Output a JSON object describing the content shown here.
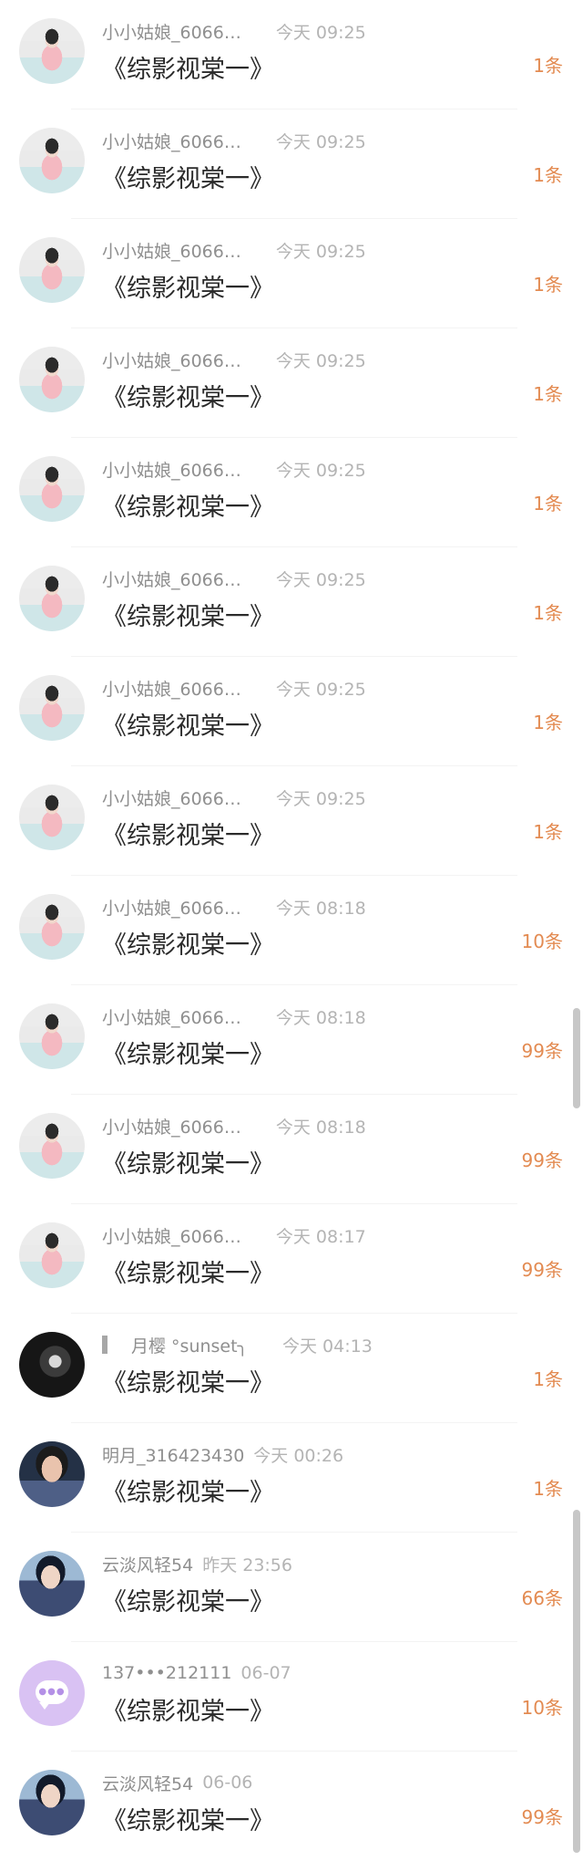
{
  "items": [
    {
      "name": "小小姑娘_6066…",
      "time": "今天  09:25",
      "title": "《综影视棠一》",
      "count": "1条"
    },
    {
      "name": "小小姑娘_6066…",
      "time": "今天  09:25",
      "title": "《综影视棠一》",
      "count": "1条"
    },
    {
      "name": "小小姑娘_6066…",
      "time": "今天  09:25",
      "title": "《综影视棠一》",
      "count": "1条"
    },
    {
      "name": "小小姑娘_6066…",
      "time": "今天  09:25",
      "title": "《综影视棠一》",
      "count": "1条"
    },
    {
      "name": "小小姑娘_6066…",
      "time": "今天  09:25",
      "title": "《综影视棠一》",
      "count": "1条"
    },
    {
      "name": "小小姑娘_6066…",
      "time": "今天  09:25",
      "title": "《综影视棠一》",
      "count": "1条"
    },
    {
      "name": "小小姑娘_6066…",
      "time": "今天  09:25",
      "title": "《综影视棠一》",
      "count": "1条"
    },
    {
      "name": "小小姑娘_6066…",
      "time": "今天  09:25",
      "title": "《综影视棠一》",
      "count": "1条"
    },
    {
      "name": "小小姑娘_6066…",
      "time": "今天  08:18",
      "title": "《综影视棠一》",
      "count": "10条"
    },
    {
      "name": "小小姑娘_6066…",
      "time": "今天  08:18",
      "title": "《综影视棠一》",
      "count": "99条"
    },
    {
      "name": "小小姑娘_6066…",
      "time": "今天  08:18",
      "title": "《综影视棠一》",
      "count": "99条"
    },
    {
      "name": "小小姑娘_6066…",
      "time": "今天  08:17",
      "title": "《综影视棠一》",
      "count": "99条"
    },
    {
      "name": "月樱 °sunset╮",
      "time": "今天  04:13",
      "title": "《综影视棠一》",
      "count": "1条"
    },
    {
      "name": "明月_316423430",
      "time": "今天  00:26",
      "title": "《综影视棠一》",
      "count": "1条"
    },
    {
      "name": "云淡风轻54",
      "time": "昨天  23:56",
      "title": "《综影视棠一》",
      "count": "66条"
    },
    {
      "name": "137•••212111",
      "time": "06-07",
      "title": "《综影视棠一》",
      "count": "10条"
    },
    {
      "name": "云淡风轻54",
      "time": "06-06",
      "title": "《综影视棠一》",
      "count": "99条"
    }
  ]
}
